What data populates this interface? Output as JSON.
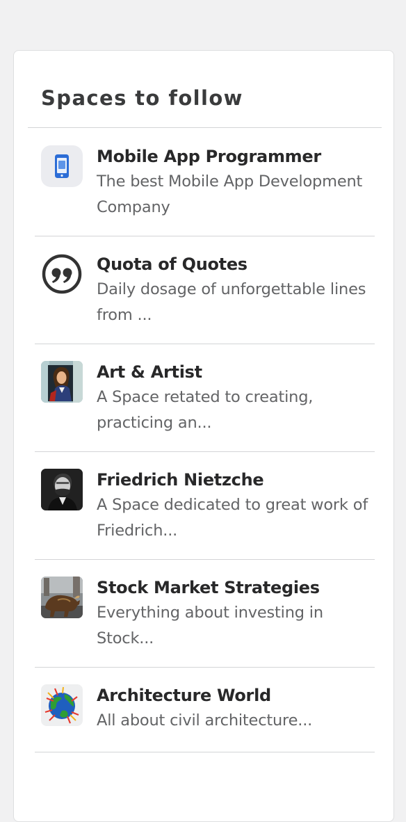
{
  "panel": {
    "title": "Spaces to follow"
  },
  "spaces": [
    {
      "name": "Mobile App Programmer",
      "description": "The best Mobile App Development Company",
      "icon": "mobile-phone-icon"
    },
    {
      "name": "Quota of Quotes",
      "description": "Daily dosage of unforgettable lines from ...",
      "icon": "quote-marks-icon"
    },
    {
      "name": "Art & Artist",
      "description": "A Space retated to creating, practicing an...",
      "icon": "portrait-painting-icon"
    },
    {
      "name": "Friedrich Nietzche",
      "description": "A Space dedicated to great work of Friedrich...",
      "icon": "portrait-photo-icon"
    },
    {
      "name": "Stock Market Strategies",
      "description": "Everything about investing in Stock...",
      "icon": "bull-statue-icon"
    },
    {
      "name": "Architecture World",
      "description": "All about civil architecture...",
      "icon": "globe-icon"
    }
  ],
  "colors": {
    "page_background": "#f1f1f2",
    "card_background": "#ffffff",
    "divider": "#d3d4d6",
    "name_text": "#282829",
    "description_text": "#636466",
    "accent_blue": "#2e69ff"
  }
}
